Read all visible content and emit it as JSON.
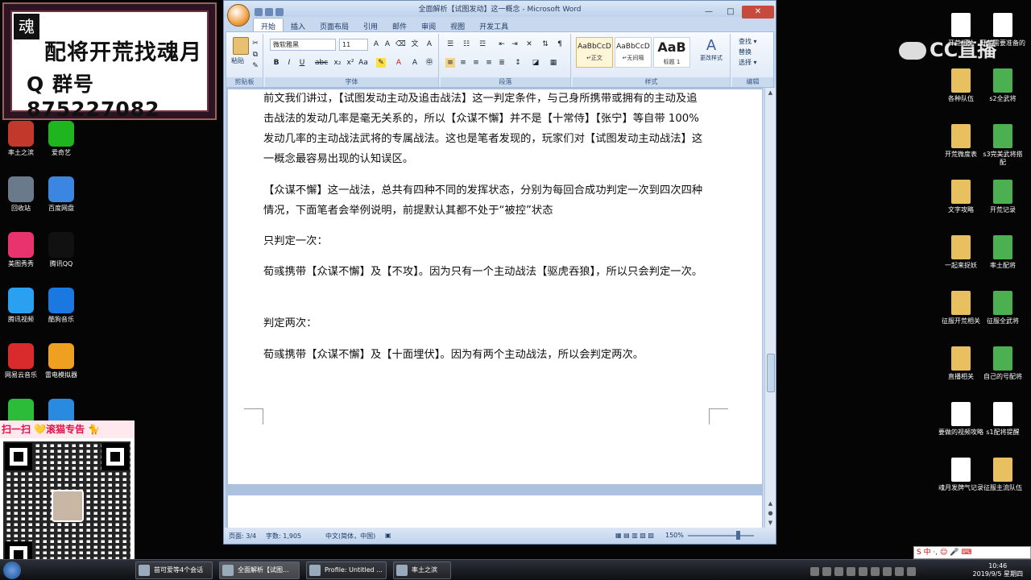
{
  "banner": {
    "logo": "魂",
    "line1": "配将开荒找魂月",
    "line2": "Q 群号 875227082"
  },
  "brand": {
    "name": "CC直播"
  },
  "left_icons": [
    {
      "label": "率土之滨",
      "color": "#c0392b"
    },
    {
      "label": "爱奇艺",
      "color": "#1fb51f"
    },
    {
      "label": "回收站",
      "color": "#6a7a8a"
    },
    {
      "label": "百度网盘",
      "color": "#3a86e0"
    },
    {
      "label": "美图秀秀",
      "color": "#e8336f"
    },
    {
      "label": "腾讯QQ",
      "color": "#111111"
    },
    {
      "label": "腾讯视频",
      "color": "#2aa0f0"
    },
    {
      "label": "酷狗音乐",
      "color": "#1b78e0"
    },
    {
      "label": "网易云音乐",
      "color": "#d92b2b"
    },
    {
      "label": "雷电模拟器",
      "color": "#f0a020"
    },
    {
      "label": "",
      "color": "#2dbb3a"
    },
    {
      "label": "",
      "color": "#2a8ae0"
    }
  ],
  "qr": {
    "title": "扫一扫 💛滚猫专告 🐈"
  },
  "right_icons": [
    {
      "label": "开荒相关",
      "type": "doc"
    },
    {
      "label": "开荒需要准备的",
      "type": "doc"
    },
    {
      "label": "各种队伍",
      "type": "folder"
    },
    {
      "label": "s2全武将",
      "type": "xls"
    },
    {
      "label": "开荒微度表",
      "type": "folder"
    },
    {
      "label": "s3完美武将搭配",
      "type": "xls"
    },
    {
      "label": "文字攻略",
      "type": "folder"
    },
    {
      "label": "开荒记录",
      "type": "xls"
    },
    {
      "label": "一起来捉妖",
      "type": "folder"
    },
    {
      "label": "率土配将",
      "type": "xls"
    },
    {
      "label": "征服开荒相关",
      "type": "folder"
    },
    {
      "label": "征服全武将",
      "type": "xls"
    },
    {
      "label": "直播相关",
      "type": "folder"
    },
    {
      "label": "自己的号配将",
      "type": "xls"
    },
    {
      "label": "要做的视频攻略",
      "type": "doc"
    },
    {
      "label": "s1配将提醒",
      "type": "doc"
    },
    {
      "label": "魂月发牌气记录",
      "type": "doc"
    },
    {
      "label": "征服主流队伍",
      "type": "folder"
    }
  ],
  "word": {
    "title": "全面解析【试图发动】这一概念 - Microsoft Word",
    "tabs": [
      "开始",
      "插入",
      "页面布局",
      "引用",
      "邮件",
      "审阅",
      "视图",
      "开发工具"
    ],
    "font_name": "微软雅黑",
    "font_size": "11",
    "groups": [
      "剪贴板",
      "字体",
      "段落",
      "样式",
      "编辑"
    ],
    "paste_label": "粘贴",
    "styles": [
      {
        "sample": "AaBbCcD",
        "name": "↵正文"
      },
      {
        "sample": "AaBbCcD",
        "name": "↵无间隔"
      },
      {
        "sample": "AaB",
        "name": "标题 1"
      }
    ],
    "change_styles": "更改样式",
    "edit_items": [
      "查找 ▾",
      "替换",
      "选择 ▾"
    ],
    "paragraphs": [
      "前文我们讲过，【试图发动主动及追击战法】这一判定条件，与己身所携带或拥有的主动及追击战法的发动几率是毫无关系的，所以【众谋不懈】并不是【十常侍】【张宁】等自带 100%发动几率的主动战法武将的专属战法。这也是笔者发现的，玩家们对【试图发动主动战法】这一概念最容易出现的认知误区。",
      "【众谋不懈】这一战法，总共有四种不同的发挥状态，分别为每回合成功判定一次到四次四种情况，下面笔者会举例说明，前提默认其都不处于“被控”状态",
      "只判定一次：",
      "荀彧携带【众谋不懈】及【不攻】。因为只有一个主动战法【驱虎吞狼】，所以只会判定一次。",
      "判定两次：",
      "荀彧携带【众谋不懈】及【十面埋伏】。因为有两个主动战法，所以会判定两次。"
    ],
    "status": {
      "page": "页面: 3/4",
      "words": "字数: 1,905",
      "lang": "中文(简体，中国)",
      "zoom": "150%"
    }
  },
  "taskbar": {
    "items": [
      {
        "label": "苗可爱等4个会话"
      },
      {
        "label": "全面解析【试图..."
      },
      {
        "label": "Profile: Untitled ..."
      },
      {
        "label": "率土之滨"
      }
    ],
    "time": "10:46",
    "date": "2019/9/5 星期四",
    "ime": "S 中 ·, ☺ 🎤 ⌨"
  }
}
